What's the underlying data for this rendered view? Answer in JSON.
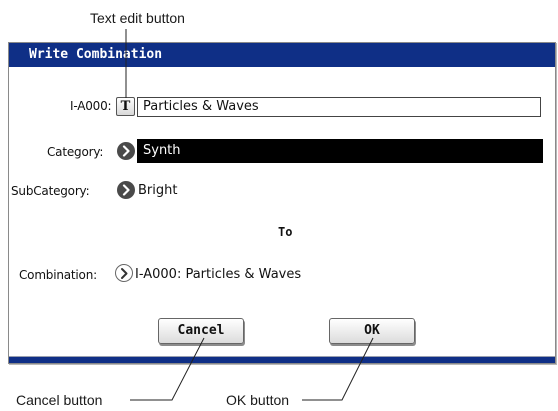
{
  "callouts": {
    "text_edit": "Text edit button",
    "cancel": "Cancel button",
    "ok": "OK button"
  },
  "dialog": {
    "title": "Write Combination",
    "name_row": {
      "label": "I-A000:",
      "text_edit_glyph": "T",
      "value": "Particles & Waves"
    },
    "category": {
      "label": "Category:",
      "value": "Synth"
    },
    "subcategory": {
      "label": "SubCategory:",
      "value": "Bright"
    },
    "to_label": "To",
    "destination": {
      "label": "Combination:",
      "value": "I-A000: Particles & Waves"
    },
    "buttons": {
      "cancel": "Cancel",
      "ok": "OK"
    }
  },
  "colors": {
    "titlebar": "#0f2f86",
    "selected_row": "#000000"
  },
  "icons": [
    "text-edit-icon",
    "arrow-right-circle-icon"
  ]
}
